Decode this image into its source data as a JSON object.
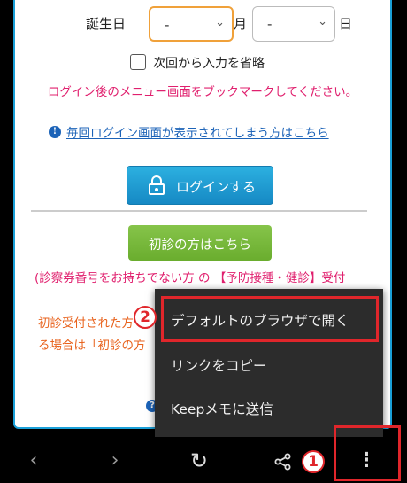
{
  "form": {
    "dob_label": "誕生日",
    "year_select_value": "-",
    "month_unit": "月",
    "month_select_value": "-",
    "day_unit": "日",
    "skip_label": "次回から入力を省略",
    "notice": "ログイン後のメニュー画面をブックマークしてください。",
    "help_link": "毎回ログイン画面が表示されてしまう方はこちら",
    "login_button": "ログインする",
    "first_visit_button": "初診の方はこちら",
    "first_visit_note": "(診察券番号をお持ちでない方 の 【予防接種・健診】受付",
    "orange_line1": "初診受付された方",
    "orange_line2": "る場合は「初診の方"
  },
  "context_menu": {
    "items": [
      "デフォルトのブラウザで開く",
      "リンクをコピー",
      "Keepメモに送信"
    ]
  },
  "annotations": {
    "step1": "1",
    "step2": "2"
  },
  "navbar": {
    "back": "‹",
    "forward": "›",
    "reload": "↻",
    "share": "share-icon",
    "more": "⋮"
  },
  "colors": {
    "accent_blue": "#1aa0d8",
    "login_button": "#1c93cc",
    "first_visit_button": "#7ab83c",
    "notice_pink": "#e0206e",
    "link_blue": "#1c63b8",
    "highlight_red": "#e0262b",
    "menu_bg": "#2c2c2c"
  }
}
